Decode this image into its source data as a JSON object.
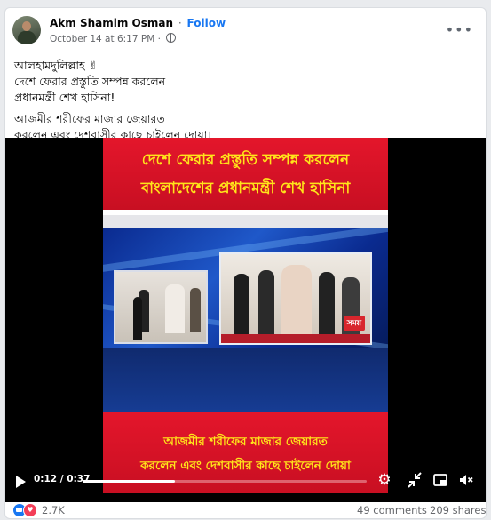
{
  "post": {
    "author": "Akm Shamim Osman",
    "separator": "·",
    "follow_label": "Follow",
    "timestamp": "October 14 at 6:17 PM ·",
    "more_label": "•••",
    "text_lines": [
      "আলহামদুলিল্লাহ ✌",
      "দেশে ফেরার প্রস্তুতি সম্পন্ন করলেন",
      "প্রধানমন্ত্রী শেখ হাসিনা!"
    ],
    "text_lines_2": [
      "আজমীর শরীফের মাজার জেয়ারত",
      "করলেন এবং দেশবাসীর কাছে চাইলেন দোয়া।"
    ]
  },
  "video": {
    "headline_top_1": "দেশে ফেরার প্রস্তুতি সম্পন্ন করলেন",
    "headline_top_2": "বাংলাদেশের প্রধানমন্ত্রী শেখ হাসিনা",
    "channel_logo": "সময়",
    "headline_bottom_1": "আজমীর শরীফের মাজার জেয়ারত",
    "headline_bottom_2": "করলেন এবং দেশবাসীর কাছে চাইলেন দোয়া",
    "current_time": "0:12",
    "duration": "0:37",
    "time_display": "0:12 / 0:37",
    "progress_fraction": 0.324
  },
  "footer": {
    "reaction_count": "2.7K",
    "comments": "49 comments",
    "shares": "209 shares"
  },
  "colors": {
    "follow": "#1877f2",
    "banner_red": "#d4142a",
    "banner_text": "#ffe51a",
    "studio_blue": "#1f58c9"
  },
  "icons": [
    "globe-icon",
    "more-icon",
    "play-icon",
    "settings-icon",
    "fullscreen-exit-icon",
    "pip-icon",
    "volume-muted-icon",
    "like-reaction-icon",
    "love-reaction-icon"
  ]
}
